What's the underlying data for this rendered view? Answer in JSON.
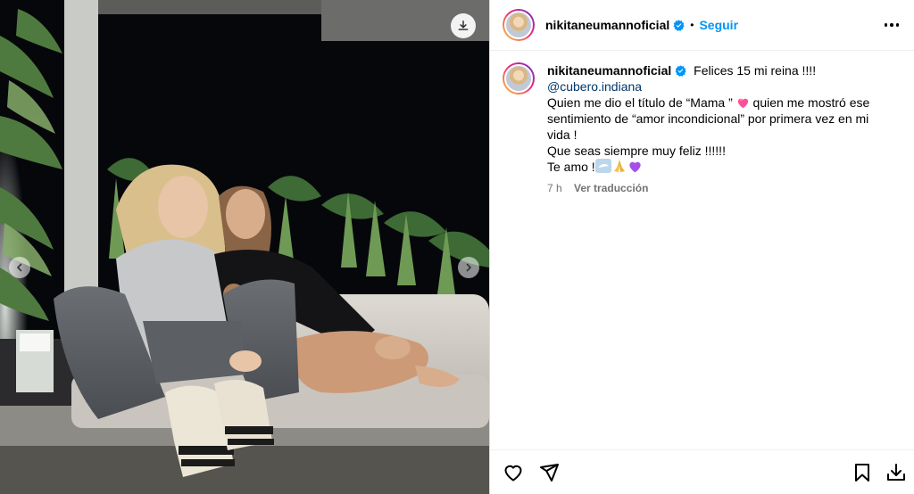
{
  "post": {
    "username": "nikitaneumannoficial",
    "separator": "•",
    "follow_label": "Seguir",
    "caption_first": "Felices 15 mi reina !!!!",
    "mention": "@cubero.indiana",
    "caption_line2_a": "Quien me dio el título de “Mama ” ",
    "caption_line2_b": " quien me mostró ese sentimiento de “amor incondicional” por primera vez en mi vida !",
    "caption_line3": "Que seas siempre muy feliz !!!!!!",
    "caption_line4": "Te amo !",
    "time": "7 h",
    "translate_label": "Ver traducción"
  },
  "icons": {
    "verified": "verified-badge-icon",
    "more": "more-options-icon",
    "download_media": "download-icon",
    "prev": "chevron-left-icon",
    "next": "chevron-right-icon",
    "like": "heart-icon",
    "share": "send-icon",
    "save": "bookmark-icon",
    "download": "download-tray-icon"
  },
  "colors": {
    "accent": "#0095f6",
    "mention": "#00376b",
    "verified": "#0095f6",
    "muted": "#737373"
  }
}
